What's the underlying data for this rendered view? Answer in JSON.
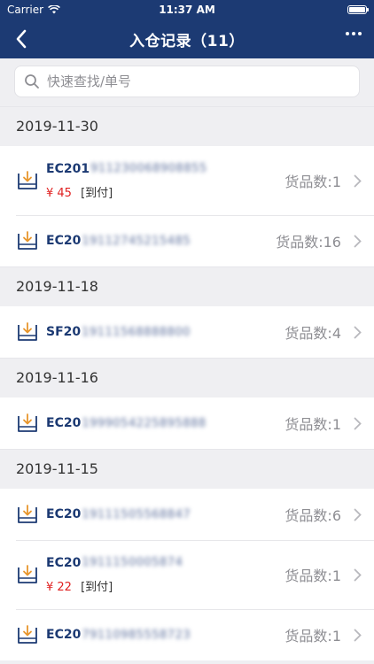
{
  "status": {
    "carrier": "Carrier",
    "time": "11:37 AM"
  },
  "nav": {
    "title": "入仓记录（11）"
  },
  "search": {
    "placeholder": "快速查找/单号"
  },
  "groups": [
    {
      "date": "2019-11-30",
      "items": [
        {
          "prefix": "EC201",
          "rest": "911230068908855",
          "count": "货品数:1",
          "price": "¥ 45",
          "pay": "[到付]"
        },
        {
          "prefix": "EC20",
          "rest": "19112745215485",
          "count": "货品数:16"
        }
      ]
    },
    {
      "date": "2019-11-18",
      "items": [
        {
          "prefix": "SF20",
          "rest": "19111568888800",
          "count": "货品数:4"
        }
      ]
    },
    {
      "date": "2019-11-16",
      "items": [
        {
          "prefix": "EC20",
          "rest": "1999054225895888",
          "count": "货品数:1"
        }
      ]
    },
    {
      "date": "2019-11-15",
      "items": [
        {
          "prefix": "EC20",
          "rest": "19111505568847",
          "count": "货品数:6"
        },
        {
          "prefix": "EC20",
          "rest": "1911150005874",
          "count": "货品数:1",
          "price": "¥ 22",
          "pay": "[到付]"
        },
        {
          "prefix": "EC20",
          "rest": "79110985558723",
          "count": "货品数:1"
        }
      ]
    }
  ]
}
